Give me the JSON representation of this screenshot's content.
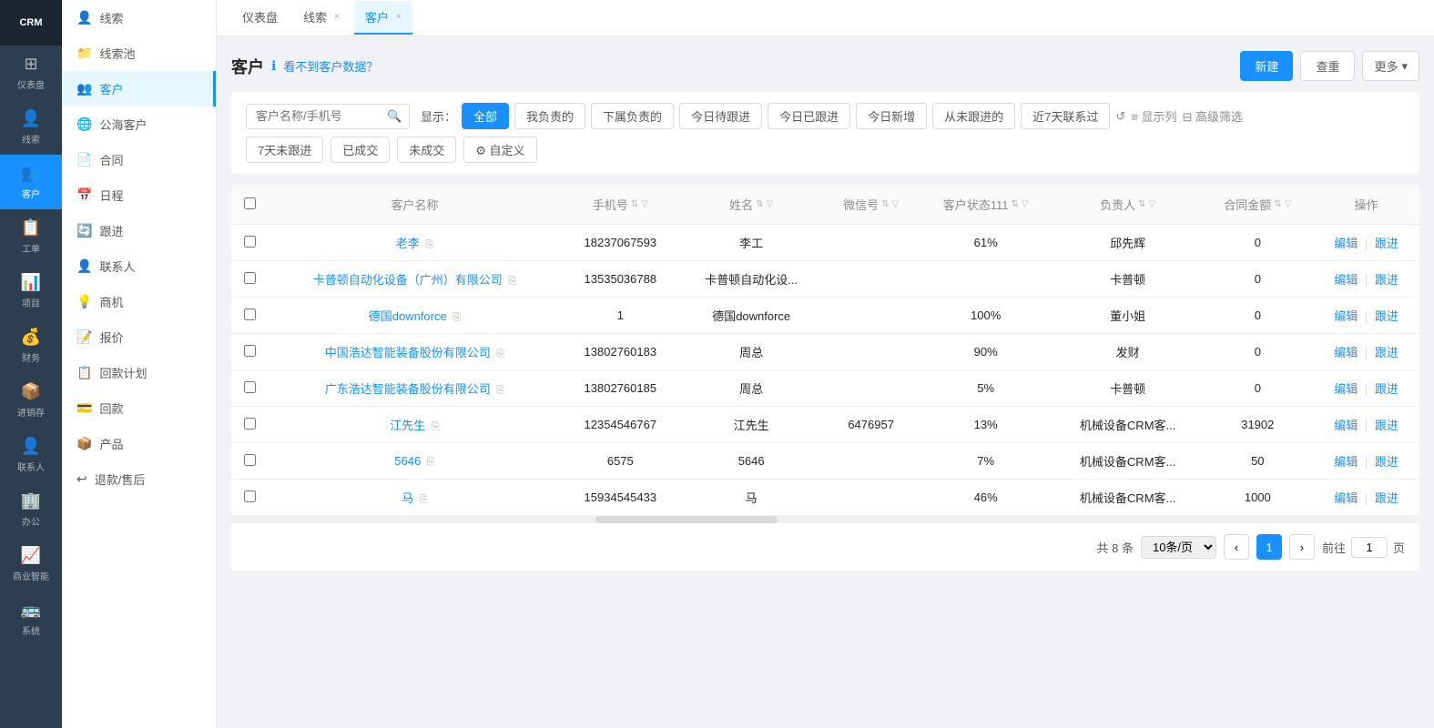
{
  "logo": {
    "text": "CRM"
  },
  "nav": {
    "items": [
      {
        "id": "dashboard",
        "label": "仪表盘",
        "icon": "⊞"
      },
      {
        "id": "leads",
        "label": "线索",
        "icon": "👤"
      },
      {
        "id": "customers",
        "label": "客户",
        "icon": "👥",
        "active": true
      },
      {
        "id": "workorder",
        "label": "工单",
        "icon": "📋"
      },
      {
        "id": "project",
        "label": "项目",
        "icon": "📊"
      },
      {
        "id": "finance",
        "label": "财务",
        "icon": "💰"
      },
      {
        "id": "inventory",
        "label": "进销存",
        "icon": "📦"
      },
      {
        "id": "contacts",
        "label": "联系人",
        "icon": "👤"
      },
      {
        "id": "office",
        "label": "办公",
        "icon": "🏢"
      },
      {
        "id": "bi",
        "label": "商业智能",
        "icon": "📈"
      },
      {
        "id": "system",
        "label": "系统",
        "icon": "🚌"
      }
    ]
  },
  "sidebar": {
    "items": [
      {
        "id": "leads",
        "label": "线索",
        "icon": "👤"
      },
      {
        "id": "leads-pool",
        "label": "线索池",
        "icon": "📁"
      },
      {
        "id": "customers",
        "label": "客户",
        "icon": "👥",
        "active": true
      },
      {
        "id": "public-customers",
        "label": "公海客户",
        "icon": "🌐"
      },
      {
        "id": "contract",
        "label": "合同",
        "icon": "📄"
      },
      {
        "id": "schedule",
        "label": "日程",
        "icon": "📅"
      },
      {
        "id": "followup",
        "label": "跟进",
        "icon": "🔄"
      },
      {
        "id": "contacts",
        "label": "联系人",
        "icon": "👤"
      },
      {
        "id": "opportunity",
        "label": "商机",
        "icon": "💡"
      },
      {
        "id": "quote",
        "label": "报价",
        "icon": "📝"
      },
      {
        "id": "payment-plan",
        "label": "回款计划",
        "icon": "📋"
      },
      {
        "id": "payment",
        "label": "回款",
        "icon": "💳"
      },
      {
        "id": "product",
        "label": "产品",
        "icon": "📦"
      },
      {
        "id": "return",
        "label": "退款/售后",
        "icon": "↩"
      }
    ]
  },
  "tabs": [
    {
      "id": "dashboard-tab",
      "label": "仪表盘",
      "active": false,
      "closeable": false
    },
    {
      "id": "leads-tab",
      "label": "线索",
      "active": false,
      "closeable": true
    },
    {
      "id": "customers-tab",
      "label": "客户",
      "active": true,
      "closeable": true
    }
  ],
  "page": {
    "title": "客户",
    "help_icon": "ℹ",
    "help_text": "看不到客户数据？",
    "new_btn": "新建",
    "reset_btn": "查重",
    "more_btn": "更多",
    "more_icon": "▾",
    "search_placeholder": "客户名称/手机号"
  },
  "display": {
    "label": "显示：",
    "filters": [
      {
        "id": "all",
        "label": "全部",
        "active": true
      },
      {
        "id": "mine",
        "label": "我负责的",
        "active": false
      },
      {
        "id": "subordinate",
        "label": "下属负责的",
        "active": false
      },
      {
        "id": "today-pending",
        "label": "今日待跟进",
        "active": false
      },
      {
        "id": "today-done",
        "label": "今日已跟进",
        "active": false
      },
      {
        "id": "today-new",
        "label": "今日新增",
        "active": false
      },
      {
        "id": "never-followed",
        "label": "从未跟进的",
        "active": false
      },
      {
        "id": "week-contact",
        "label": "近7天联系过",
        "active": false
      }
    ],
    "second_row": [
      {
        "id": "week-no-follow",
        "label": "7天未跟进",
        "active": false
      },
      {
        "id": "closed",
        "label": "已成交",
        "active": false
      },
      {
        "id": "not-closed",
        "label": "未成交",
        "active": false
      },
      {
        "id": "custom",
        "label": "⚙ 自定义",
        "active": false
      }
    ]
  },
  "toolbar": {
    "refresh_icon": "↺",
    "columns_label": "≡ 显示列",
    "advanced_filter": "⊟ 高级筛选"
  },
  "table": {
    "columns": [
      {
        "id": "checkbox",
        "label": ""
      },
      {
        "id": "name",
        "label": "客户名称"
      },
      {
        "id": "phone",
        "label": "手机号"
      },
      {
        "id": "contact-name",
        "label": "姓名"
      },
      {
        "id": "wechat",
        "label": "微信号"
      },
      {
        "id": "status",
        "label": "客户状态111"
      },
      {
        "id": "owner",
        "label": "负责人"
      },
      {
        "id": "contract-amount",
        "label": "合同金额"
      },
      {
        "id": "action",
        "label": "操作"
      }
    ],
    "rows": [
      {
        "name": "老李",
        "name_link": true,
        "phone": "18237067593",
        "contact_name": "李工",
        "wechat": "",
        "status": "61%",
        "owner": "邱先辉",
        "contract_amount": "0",
        "edit": "编辑",
        "follow": "跟进"
      },
      {
        "name": "卡普顿自动化设备（广州）有限公司",
        "name_link": true,
        "phone": "13535036788",
        "contact_name": "卡普顿自动化设...",
        "wechat": "",
        "status": "",
        "owner": "卡普顿",
        "contract_amount": "0",
        "edit": "编辑",
        "follow": "跟进"
      },
      {
        "name": "德国downforce",
        "name_link": true,
        "phone": "1",
        "contact_name": "德国downforce",
        "wechat": "",
        "status": "100%",
        "owner": "董小姐",
        "contract_amount": "0",
        "edit": "编辑",
        "follow": "跟进"
      },
      {
        "name": "中国浩达智能装备股份有限公司",
        "name_link": true,
        "phone": "13802760183",
        "contact_name": "周总",
        "wechat": "",
        "status": "90%",
        "owner": "发财",
        "contract_amount": "0",
        "edit": "编辑",
        "follow": "跟进"
      },
      {
        "name": "广东浩达智能装备股份有限公司",
        "name_link": true,
        "phone": "13802760185",
        "contact_name": "周总",
        "wechat": "",
        "status": "5%",
        "owner": "卡普顿",
        "contract_amount": "0",
        "edit": "编辑",
        "follow": "跟进"
      },
      {
        "name": "江先生",
        "name_link": true,
        "phone": "12354546767",
        "contact_name": "江先生",
        "wechat": "6476957",
        "status": "13%",
        "owner": "机械设备CRM客...",
        "contract_amount": "31902",
        "edit": "编辑",
        "follow": "跟进"
      },
      {
        "name": "5646",
        "name_link": true,
        "phone": "6575",
        "contact_name": "5646",
        "wechat": "",
        "status": "7%",
        "owner": "机械设备CRM客...",
        "contract_amount": "50",
        "edit": "编辑",
        "follow": "跟进"
      },
      {
        "name": "马",
        "name_link": true,
        "phone": "15934545433",
        "contact_name": "马",
        "wechat": "",
        "status": "46%",
        "owner": "机械设备CRM客...",
        "contract_amount": "1000",
        "edit": "编辑",
        "follow": "跟进"
      }
    ]
  },
  "pagination": {
    "total_prefix": "共",
    "total": "8",
    "total_suffix": "条",
    "page_size": "10条/页",
    "current_page": "1",
    "goto_prefix": "前往",
    "goto_suffix": "页"
  }
}
